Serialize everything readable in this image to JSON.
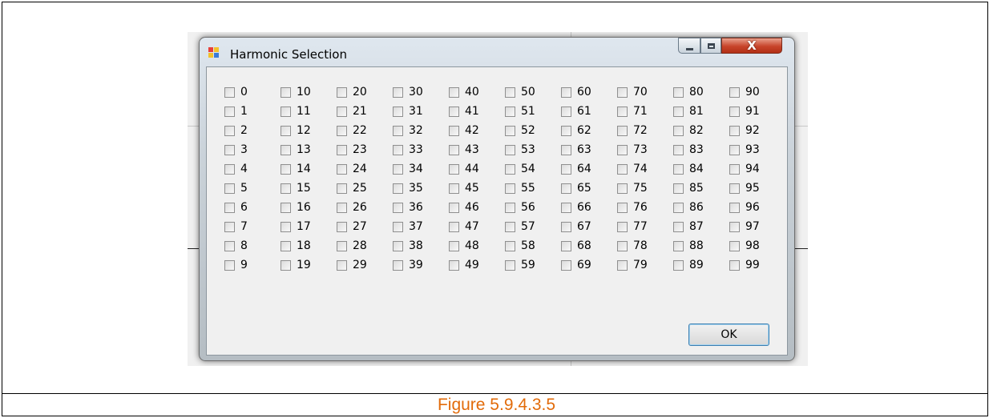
{
  "window": {
    "title": "Harmonic Selection",
    "close_glyph": "X"
  },
  "checkboxes": [
    {
      "label": "0"
    },
    {
      "label": "1"
    },
    {
      "label": "2"
    },
    {
      "label": "3"
    },
    {
      "label": "4"
    },
    {
      "label": "5"
    },
    {
      "label": "6"
    },
    {
      "label": "7"
    },
    {
      "label": "8"
    },
    {
      "label": "9"
    },
    {
      "label": "10"
    },
    {
      "label": "11"
    },
    {
      "label": "12"
    },
    {
      "label": "13"
    },
    {
      "label": "14"
    },
    {
      "label": "15"
    },
    {
      "label": "16"
    },
    {
      "label": "17"
    },
    {
      "label": "18"
    },
    {
      "label": "19"
    },
    {
      "label": "20"
    },
    {
      "label": "21"
    },
    {
      "label": "22"
    },
    {
      "label": "23"
    },
    {
      "label": "24"
    },
    {
      "label": "25"
    },
    {
      "label": "26"
    },
    {
      "label": "27"
    },
    {
      "label": "28"
    },
    {
      "label": "29"
    },
    {
      "label": "30"
    },
    {
      "label": "31"
    },
    {
      "label": "32"
    },
    {
      "label": "33"
    },
    {
      "label": "34"
    },
    {
      "label": "35"
    },
    {
      "label": "36"
    },
    {
      "label": "37"
    },
    {
      "label": "38"
    },
    {
      "label": "39"
    },
    {
      "label": "40"
    },
    {
      "label": "41"
    },
    {
      "label": "42"
    },
    {
      "label": "43"
    },
    {
      "label": "44"
    },
    {
      "label": "45"
    },
    {
      "label": "46"
    },
    {
      "label": "47"
    },
    {
      "label": "48"
    },
    {
      "label": "49"
    },
    {
      "label": "50"
    },
    {
      "label": "51"
    },
    {
      "label": "52"
    },
    {
      "label": "53"
    },
    {
      "label": "54"
    },
    {
      "label": "55"
    },
    {
      "label": "56"
    },
    {
      "label": "57"
    },
    {
      "label": "58"
    },
    {
      "label": "59"
    },
    {
      "label": "60"
    },
    {
      "label": "61"
    },
    {
      "label": "62"
    },
    {
      "label": "63"
    },
    {
      "label": "64"
    },
    {
      "label": "65"
    },
    {
      "label": "66"
    },
    {
      "label": "67"
    },
    {
      "label": "68"
    },
    {
      "label": "69"
    },
    {
      "label": "70"
    },
    {
      "label": "71"
    },
    {
      "label": "72"
    },
    {
      "label": "73"
    },
    {
      "label": "74"
    },
    {
      "label": "75"
    },
    {
      "label": "76"
    },
    {
      "label": "77"
    },
    {
      "label": "78"
    },
    {
      "label": "79"
    },
    {
      "label": "80"
    },
    {
      "label": "81"
    },
    {
      "label": "82"
    },
    {
      "label": "83"
    },
    {
      "label": "84"
    },
    {
      "label": "85"
    },
    {
      "label": "86"
    },
    {
      "label": "87"
    },
    {
      "label": "88"
    },
    {
      "label": "89"
    },
    {
      "label": "90"
    },
    {
      "label": "91"
    },
    {
      "label": "92"
    },
    {
      "label": "93"
    },
    {
      "label": "94"
    },
    {
      "label": "95"
    },
    {
      "label": "96"
    },
    {
      "label": "97"
    },
    {
      "label": "98"
    },
    {
      "label": "99"
    }
  ],
  "ok_button": {
    "label": "OK"
  },
  "caption": {
    "text": "Figure 5.9.4.3.5"
  },
  "colors": {
    "caption": "#e26b0a",
    "close_button": "#c7442a",
    "ok_border": "#3c7fb1"
  }
}
